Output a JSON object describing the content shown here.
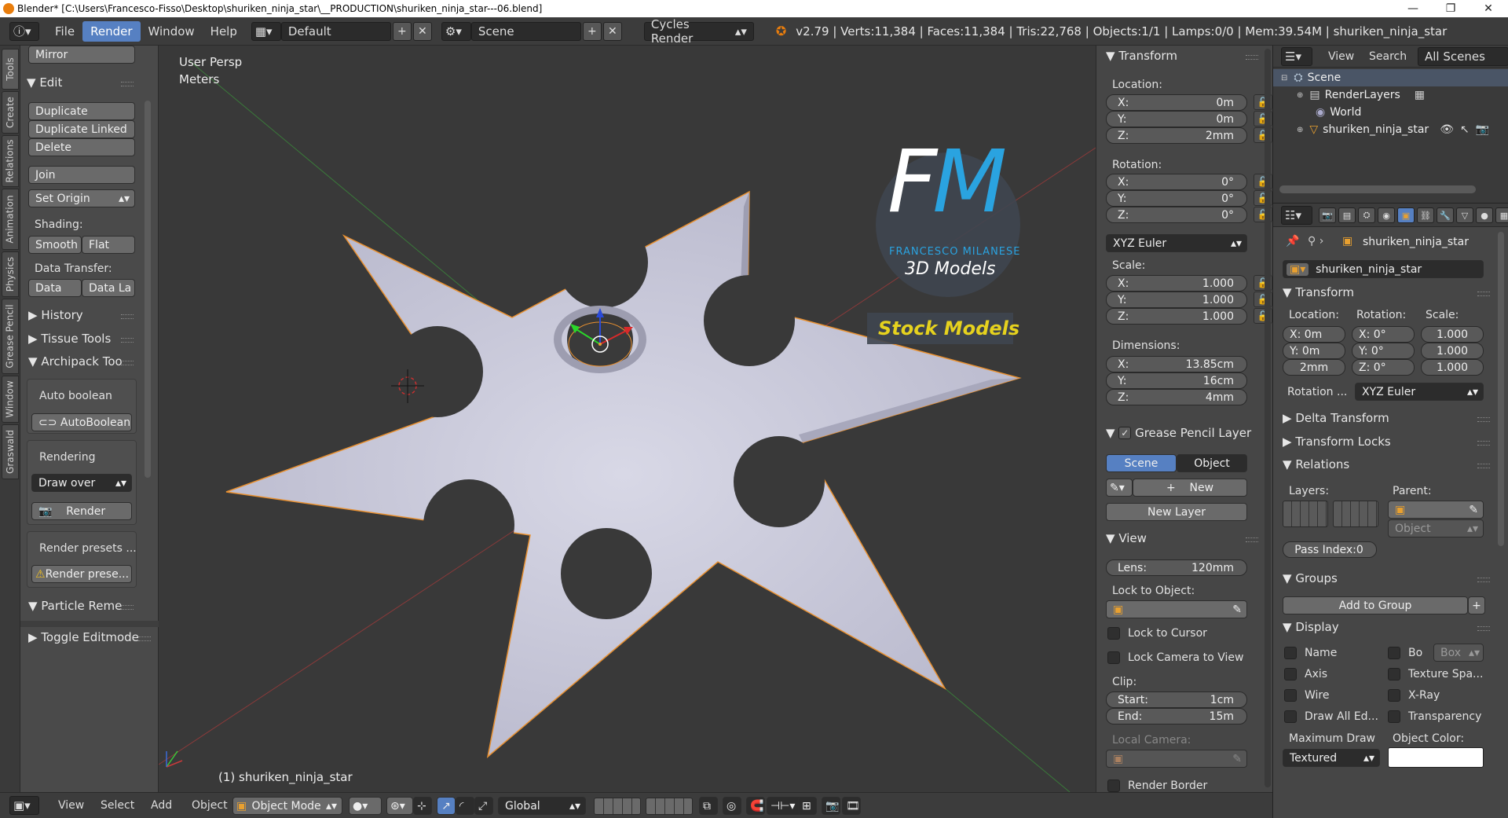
{
  "window": {
    "title": "Blender* [C:\\Users\\Francesco-Fisso\\Desktop\\shuriken_ninja_star\\__PRODUCTION\\shuriken_ninja_star---06.blend]",
    "minimize": "—",
    "maximize": "❐",
    "close": "✕"
  },
  "info_header": {
    "menus": [
      "File",
      "Render",
      "Window",
      "Help"
    ],
    "active_menu": "Render",
    "layout": "Default",
    "scene": "Scene",
    "engine": "Cycles Render",
    "stats": "v2.79 | Verts:11,384 | Faces:11,384 | Tris:22,768 | Objects:1/1 | Lamps:0/0 | Mem:39.54M | shuriken_ninja_star"
  },
  "tool_tabs": [
    "Tools",
    "Create",
    "Relations",
    "Animation",
    "Physics",
    "Grease Pencil",
    "Window",
    "Graswald"
  ],
  "tool_shelf": {
    "mirror": "Mirror",
    "edit_header": "Edit",
    "duplicate": "Duplicate",
    "duplicate_linked": "Duplicate Linked",
    "delete": "Delete",
    "join": "Join",
    "set_origin": "Set Origin",
    "shading_label": "Shading:",
    "smooth": "Smooth",
    "flat": "Flat",
    "data_transfer_label": "Data Transfer:",
    "data": "Data",
    "data_layout": "Data La",
    "history": "History",
    "tissue_tools": "Tissue Tools",
    "archipack": "Archipack Too",
    "auto_boolean_label": "Auto boolean",
    "auto_boolean_btn": "AutoBoolean",
    "rendering_label": "Rendering",
    "draw_over": "Draw over",
    "render_btn": "Render",
    "render_presets_label": "Render presets ...",
    "render_presets_btn": "Render prese...",
    "particle_remesh": "Particle Reme",
    "toggle_editmode": "Toggle Editmode"
  },
  "viewport": {
    "view_name": "User Persp",
    "units": "Meters",
    "object_label": "(1) shuriken_ninja_star",
    "logo_letters": "FM",
    "logo_name": "FRANCESCO MILANESE",
    "logo_sub": "3D Models",
    "stock_label": "Stock Models"
  },
  "npanel": {
    "transform_header": "Transform",
    "location_label": "Location:",
    "location": [
      {
        "axis": "X:",
        "value": "0m"
      },
      {
        "axis": "Y:",
        "value": "0m"
      },
      {
        "axis": "Z:",
        "value": "2mm"
      }
    ],
    "rotation_label": "Rotation:",
    "rotation": [
      {
        "axis": "X:",
        "value": "0°"
      },
      {
        "axis": "Y:",
        "value": "0°"
      },
      {
        "axis": "Z:",
        "value": "0°"
      }
    ],
    "rotation_mode": "XYZ Euler",
    "scale_label": "Scale:",
    "scale": [
      {
        "axis": "X:",
        "value": "1.000"
      },
      {
        "axis": "Y:",
        "value": "1.000"
      },
      {
        "axis": "Z:",
        "value": "1.000"
      }
    ],
    "dimensions_label": "Dimensions:",
    "dimensions": [
      {
        "axis": "X:",
        "value": "13.85cm"
      },
      {
        "axis": "Y:",
        "value": "16cm"
      },
      {
        "axis": "Z:",
        "value": "4mm"
      }
    ],
    "grease_header": "Grease Pencil Layer",
    "scene_btn": "Scene",
    "object_btn": "Object",
    "new_btn": "New",
    "new_layer_btn": "New Layer",
    "view_header": "View",
    "lens_label": "Lens:",
    "lens_value": "120mm",
    "lock_object_label": "Lock to Object:",
    "lock_cursor": "Lock to Cursor",
    "lock_camera": "Lock Camera to View",
    "clip_label": "Clip:",
    "clip_start_label": "Start:",
    "clip_start": "1cm",
    "clip_end_label": "End:",
    "clip_end": "15m",
    "local_camera_label": "Local Camera:",
    "render_border": "Render Border"
  },
  "outliner": {
    "view": "View",
    "search": "Search",
    "filter": "All Scenes",
    "items": [
      {
        "name": "Scene",
        "level": 0
      },
      {
        "name": "RenderLayers",
        "level": 1
      },
      {
        "name": "World",
        "level": 1
      },
      {
        "name": "shuriken_ninja_star",
        "level": 1
      }
    ]
  },
  "properties": {
    "breadcrumb": "shuriken_ninja_star",
    "object_name": "shuriken_ninja_star",
    "transform_header": "Transform",
    "location_label": "Location:",
    "rotation_label": "Rotation:",
    "scale_label": "Scale:",
    "loc": [
      "X: 0m",
      "Y: 0m",
      "2mm"
    ],
    "rot": [
      "X:   0°",
      "Y:   0°",
      "Z:   0°"
    ],
    "scl": [
      "1.000",
      "1.000",
      "1.000"
    ],
    "rotation_mode_label": "Rotation ...",
    "rotation_mode": "XYZ Euler",
    "delta_transform": "Delta Transform",
    "transform_locks": "Transform Locks",
    "relations": "Relations",
    "layers_label": "Layers:",
    "parent_label": "Parent:",
    "parent_type": "Object",
    "pass_index": "Pass Index:0",
    "groups": "Groups",
    "add_to_group": "Add to Group",
    "display": "Display",
    "name_chk": "Name",
    "bo_chk": "Bo",
    "box": "Box",
    "axis_chk": "Axis",
    "texture_space": "Texture Spa...",
    "wire_chk": "Wire",
    "xray_chk": "X-Ray",
    "draw_all": "Draw All Ed...",
    "transparency": "Transparency",
    "maximum_draw": "Maximum Draw",
    "object_color": "Object Color:",
    "textured": "Textured"
  },
  "bottom_header": {
    "menus": [
      "View",
      "Select",
      "Add",
      "Object"
    ],
    "mode": "Object Mode",
    "orientation": "Global"
  },
  "colors": {
    "accent": "#5680c2",
    "star_fill": "#c4c4d4",
    "logo_cyan": "#2aa3e0",
    "stock_yellow": "#e6d21e"
  }
}
